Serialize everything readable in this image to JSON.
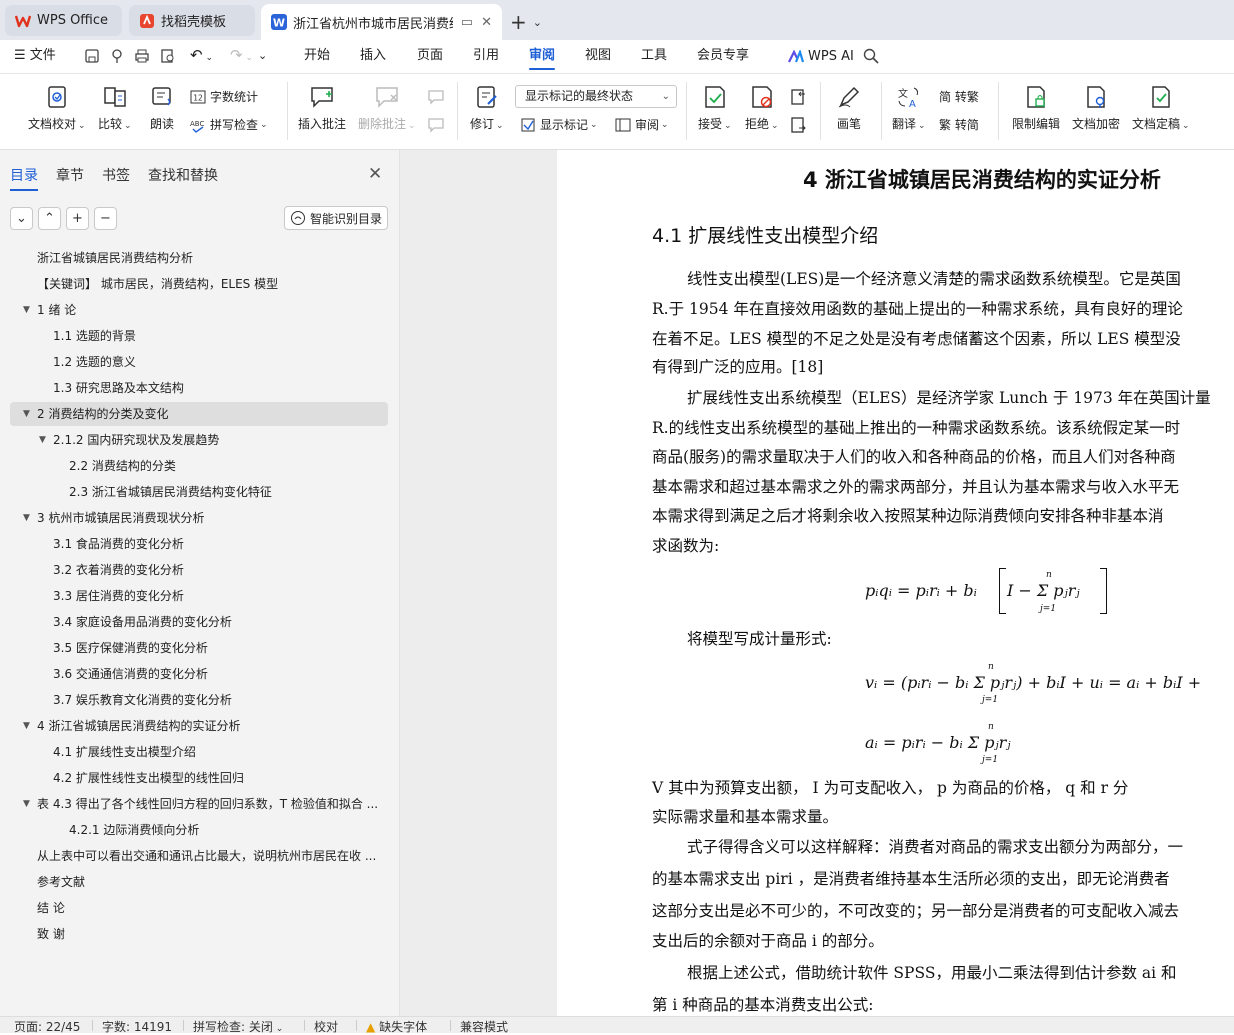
{
  "tabs": {
    "wps": "WPS Office",
    "daoke": "找稻壳模板",
    "doc": "浙江省杭州市城市居民消费结构"
  },
  "menu": {
    "file": "文件",
    "items": [
      "开始",
      "插入",
      "页面",
      "引用",
      "审阅",
      "视图",
      "工具",
      "会员专享"
    ],
    "active": "审阅",
    "ai": "WPS AI"
  },
  "ribbon": {
    "proof": "文档校对",
    "compare": "比较",
    "read": "朗读",
    "wordcount": "字数统计",
    "spellcheck": "拼写检查",
    "insert_comment": "插入批注",
    "delete_comment": "删除批注",
    "revise": "修订",
    "markup_select": "显示标记的最终状态",
    "show_markup": "显示标记",
    "review": "审阅",
    "accept": "接受",
    "reject": "拒绝",
    "ink": "画笔",
    "translate": "翻译",
    "to_trad": "简 转繁",
    "to_simp": "繁 转简",
    "restrict": "限制编辑",
    "encrypt": "文档加密",
    "finalize": "文档定稿"
  },
  "panel": {
    "tabs": [
      "目录",
      "章节",
      "书签",
      "查找和替换"
    ],
    "smart_toc": "智能识别目录",
    "toc": [
      {
        "text": "浙江省城镇居民消费结构分析",
        "level": 0,
        "twisty": ""
      },
      {
        "text": "【关键词】  城市居民，消费结构，ELES 模型",
        "level": 0,
        "twisty": ""
      },
      {
        "text": "1  绪  论",
        "level": 0,
        "twisty": "▼"
      },
      {
        "text": "1.1 选题的背景",
        "level": 1,
        "twisty": ""
      },
      {
        "text": "1.2 选题的意义",
        "level": 1,
        "twisty": ""
      },
      {
        "text": "1.3 研究思路及本文结构",
        "level": 1,
        "twisty": ""
      },
      {
        "text": "2 消费结构的分类及变化",
        "level": 0,
        "twisty": "▼"
      },
      {
        "text": "2.1.2 国内研究现状及发展趋势",
        "level": 1,
        "twisty": "▼"
      },
      {
        "text": "2.2  消费结构的分类",
        "level": 2,
        "twisty": ""
      },
      {
        "text": "2.3 浙江省城镇居民消费结构变化特征",
        "level": 2,
        "twisty": ""
      },
      {
        "text": "3  杭州市城镇居民消费现状分析",
        "level": 0,
        "twisty": "▼"
      },
      {
        "text": "3.1 食品消费的变化分析",
        "level": 1,
        "twisty": ""
      },
      {
        "text": "3.2 衣着消费的变化分析",
        "level": 1,
        "twisty": ""
      },
      {
        "text": "3.3 居住消费的变化分析",
        "level": 1,
        "twisty": ""
      },
      {
        "text": "3.4 家庭设备用品消费的变化分析",
        "level": 1,
        "twisty": ""
      },
      {
        "text": "3.5 医疗保健消费的变化分析",
        "level": 1,
        "twisty": ""
      },
      {
        "text": "3.6 交通通信消费的变化分析",
        "level": 1,
        "twisty": ""
      },
      {
        "text": "3.7 娱乐教育文化消费的变化分析",
        "level": 1,
        "twisty": ""
      },
      {
        "text": "4  浙江省城镇居民消费结构的实证分析",
        "level": 0,
        "twisty": "▼"
      },
      {
        "text": "4.1  扩展线性支出模型介绍",
        "level": 1,
        "twisty": ""
      },
      {
        "text": "4.2 扩展性线性支出模型的线性回归",
        "level": 1,
        "twisty": ""
      },
      {
        "text": "表 4.3 得出了各个线性回归方程的回归系数，T 检验值和拟合 ...",
        "level": 0,
        "twisty": "▼"
      },
      {
        "text": "4.2.1  边际消费倾向分析",
        "level": 2,
        "twisty": ""
      },
      {
        "text": "从上表中可以看出交通和通讯占比最大，说明杭州市居民在收 ...",
        "level": 0,
        "twisty": ""
      },
      {
        "text": "参考文献",
        "level": 0,
        "twisty": ""
      },
      {
        "text": "结  论",
        "level": 0,
        "twisty": ""
      },
      {
        "text": "致  谢",
        "level": 0,
        "twisty": ""
      }
    ],
    "selected_index": 6
  },
  "document": {
    "chapter_title": "4  浙江省城镇居民消费结构的实证分析",
    "section_title": "4.1  扩展线性支出模型介绍",
    "lines": [
      "线性支出模型(LES)是一个经济意义清楚的需求函数系统模型。它是英国",
      "R.于 1954 年在直接效用函数的基础上提出的一种需求系统，具有良好的理论",
      "在着不足。LES 模型的不足之处是没有考虑储蓄这个因素，所以  LES 模型没",
      "有得到广泛的应用。[18]",
      "扩展线性支出系统模型（ELES）是经济学家 Lunch 于 1973 年在英国计量",
      "R.的线性支出系统模型的基础上推出的一种需求函数系统。该系统假定某一时",
      "商品(服务)的需求量取决于人们的收入和各种商品的价格，而且人们对各种商",
      "基本需求和超过基本需求之外的需求两部分，并且认为基本需求与收入水平无",
      "本需求得到满足之后才将剩余收入按照某种边际消费倾向安排各种非基本消",
      "求函数为:",
      "将模型写成计量形式:",
      "V 其中为预算支出额，  I   为可支配收入，  p   为商品的价格，  q   和 r   分",
      "实际需求量和基本需求量。",
      "式子得得含义可以这样解释：消费者对商品的需求支出额分为两部分，一",
      "的基本需求支出 piri  ，是消费者维持基本生活所必须的支出，即无论消费者",
      "这部分支出是必不可少的，不可改变的；另一部分是消费者的可支配收入减去",
      "支出后的余额对于商品 i   的部分。",
      "根据上述公式，借助统计软件 SPSS，用最小二乘法得到估计参数 ai   和",
      "第 i   种商品的基本消费支出公式:"
    ],
    "eq1": "pᵢqᵢ  =  pᵢrᵢ  +  bᵢ",
    "eq1_bracket": "I  −  Σ pⱼrⱼ",
    "eq2": "vᵢ  =  (pᵢrᵢ  −  bᵢ Σ pⱼrⱼ)  +  bᵢI  +  uᵢ  =  aᵢ  +  bᵢI  +",
    "eq3": "aᵢ  =  pᵢrᵢ  −  bᵢ Σ pⱼrⱼ",
    "sum_top": "n",
    "sum_bottom": "j=1"
  },
  "status": {
    "page": "页面: 22/45",
    "words": "字数: 14191",
    "spell": "拼写检查: 关闭",
    "proof": "校对",
    "missing_font": "缺失字体",
    "compat": "兼容模式"
  }
}
